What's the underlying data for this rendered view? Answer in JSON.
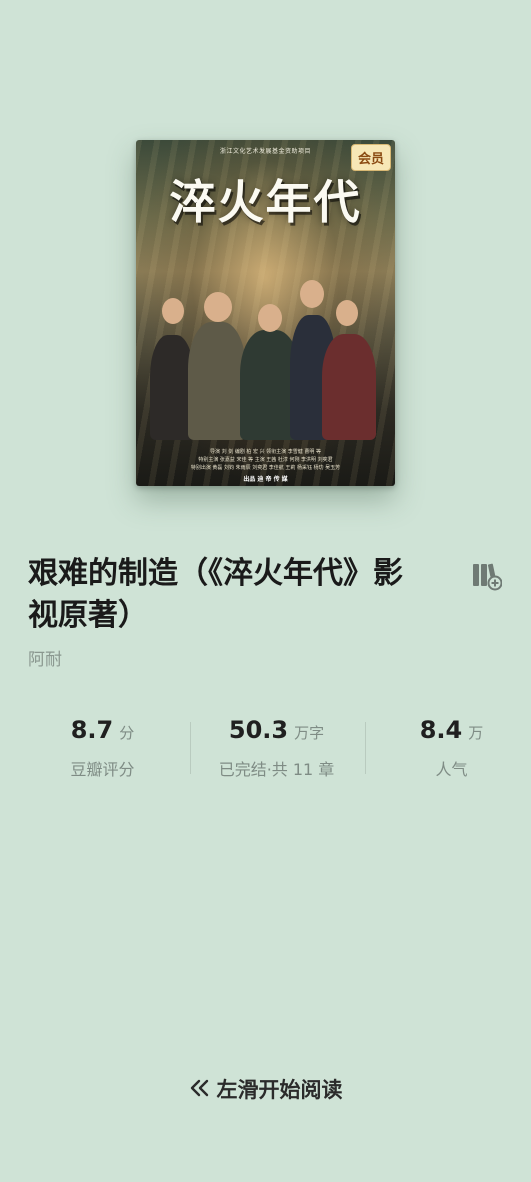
{
  "cover": {
    "top_text": "浙江文化艺术发展基金资助项目",
    "badge": "会员",
    "title": "淬火年代",
    "credits_line1": "导演 刘 剑    编剧 柏 宏 兴    领衔主演 李雪健 曹明 等",
    "credits_line2": "特别主演 张嘉益 宋佳 等    主演 王茜 杜淳 何刚 李洪明 刘奕君",
    "credits_line3": "特别出演 黄磊 刘钧 朱雨辰 刘奕君 李佳航 王莉 杨采钰 杨玏 吴玉芳",
    "bottom_text": "出品 迪 帝 传 媒"
  },
  "book": {
    "title": "艰难的制造（《淬火年代》影视原著）",
    "author": "阿耐"
  },
  "stats": [
    {
      "value": "8.7",
      "unit": "分",
      "label": "豆瓣评分"
    },
    {
      "value": "50.3",
      "unit": "万字",
      "label": "已完结·共 11 章"
    },
    {
      "value": "8.4",
      "unit": "万",
      "label": "人气"
    }
  ],
  "footer": {
    "swipe_hint": "左滑开始阅读",
    "swipe_icon": "double-chevron-left-icon"
  },
  "icons": {
    "shelf": "add-to-bookshelf-icon"
  },
  "colors": {
    "background": "#cfe3d6",
    "muted_text": "#7f8c85",
    "badge_bg": "#f7e7b6"
  }
}
